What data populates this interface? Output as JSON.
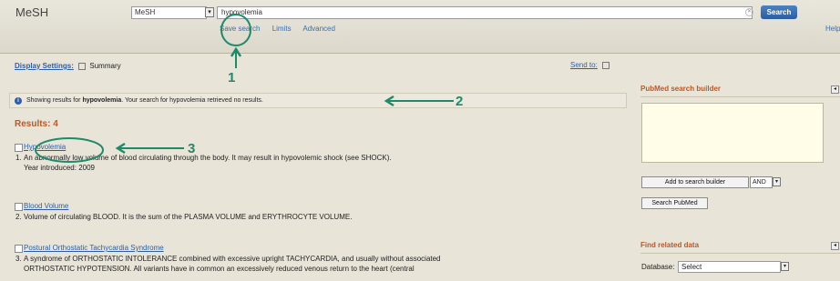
{
  "header": {
    "db_label": "MeSH",
    "db_select_value": "MeSH",
    "search_value": "hypovolemia",
    "search_button": "Search",
    "subnav": [
      "Save search",
      "Limits",
      "Advanced"
    ],
    "help": "Help"
  },
  "main": {
    "display_settings": "Display Settings:",
    "summary": "Summary",
    "send_to": "Send to:",
    "info_prefix": "Showing results for",
    "info_term": "hypovolemia",
    "info_suffix": ". Your search for hypovolemia retrieved no results.",
    "results_count": "Results: 4",
    "results": [
      {
        "num": "1.",
        "title": "Hypovolemia",
        "desc": "An abnormally low volume of blood circulating through the body. It may result in hypovolemic shock (see SHOCK).",
        "year": "Year introduced: 2009"
      },
      {
        "num": "2.",
        "title": "Blood Volume",
        "desc": "Volume of circulating BLOOD. It is the sum of the PLASMA VOLUME and ERYTHROCYTE VOLUME.",
        "year": ""
      },
      {
        "num": "3.",
        "title": "Postural Orthostatic Tachycardia Syndrome",
        "desc": "A syndrome of ORTHOSTATIC INTOLERANCE combined with excessive upright TACHYCARDIA, and usually without associated",
        "year": "ORTHOSTATIC HYPOTENSION. All variants have in common an excessively reduced venous return to the heart (central"
      }
    ]
  },
  "sidebar": {
    "builder_title": "PubMed search builder",
    "add_button": "Add to search builder",
    "operator": "AND",
    "search_pubmed": "Search PubMed",
    "related_title": "Find related data",
    "database_label": "Database:",
    "database_value": "Select"
  },
  "annotations": {
    "a1": "1",
    "a2": "2",
    "a3": "3"
  },
  "colors": {
    "annotation": "#1f8a6a",
    "link": "#2d5fa7",
    "accent": "#b65a2a"
  }
}
